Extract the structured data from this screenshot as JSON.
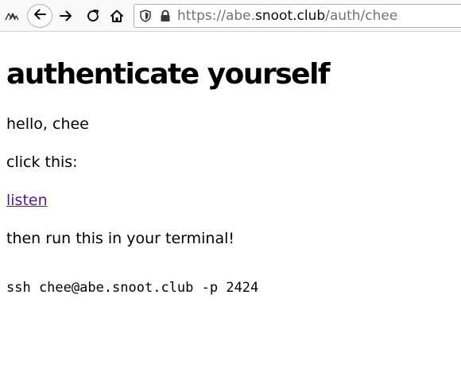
{
  "browser": {
    "url": {
      "scheme": "https://",
      "subdomain": "abe.",
      "domain": "snoot.club",
      "path": "/auth/chee"
    },
    "icons": {
      "extension": "extension-icon",
      "back": "arrow-left-icon",
      "forward": "arrow-right-icon",
      "reload": "reload-icon",
      "home": "home-icon",
      "tracking": "shield-icon",
      "secure": "lock-icon"
    }
  },
  "page": {
    "title": "authenticate yourself",
    "greeting": "hello, chee",
    "click_prompt": "click this:",
    "link_label": "listen",
    "instruction": "then run this in your terminal!",
    "command": "ssh chee@abe.snoot.club -p 2424"
  },
  "colors": {
    "visited_link": "#551a8b",
    "toolbar_bg": "#f9f9fa",
    "url_muted": "#737373"
  }
}
